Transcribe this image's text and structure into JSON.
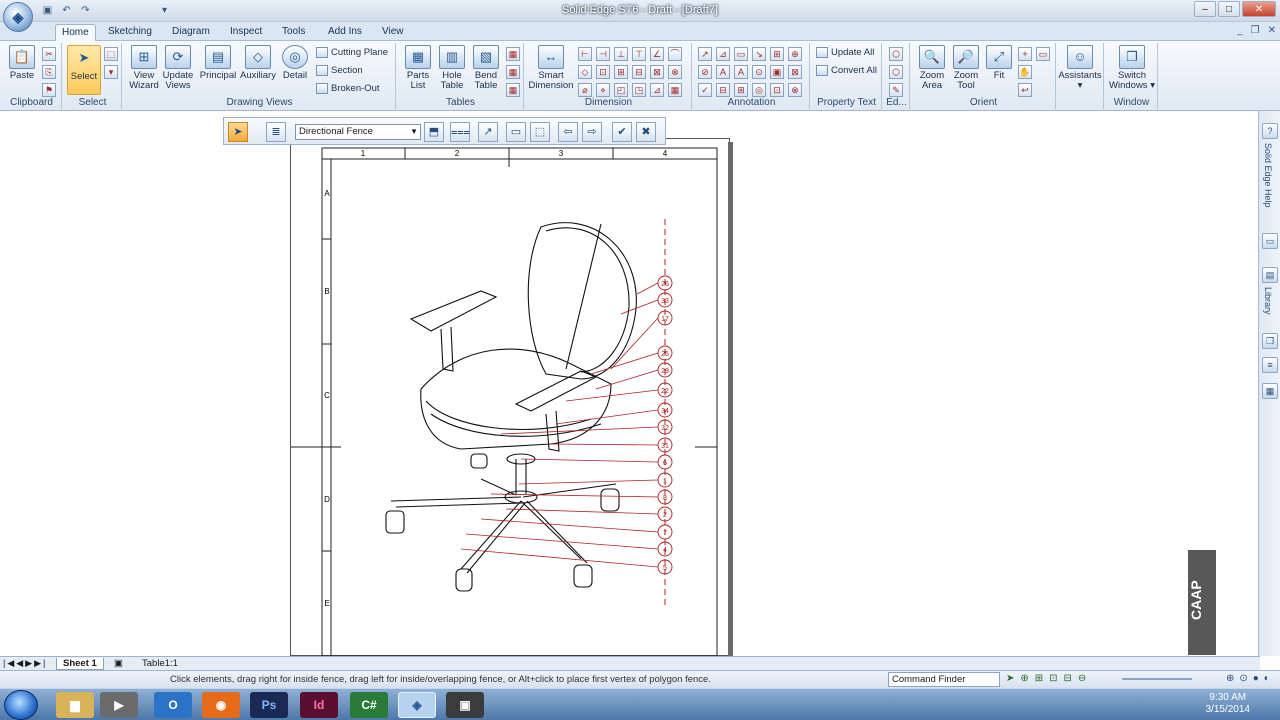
{
  "window": {
    "title": "Solid Edge ST6 - Draft - [Draft7]"
  },
  "tabs": [
    "Home",
    "Sketching",
    "Diagram",
    "Inspect",
    "Tools",
    "Add Ins",
    "View"
  ],
  "ribbon": {
    "clipboard": {
      "label": "Clipboard",
      "paste": "Paste"
    },
    "select": {
      "label": "Select",
      "select": "Select"
    },
    "drawing_views": {
      "label": "Drawing Views",
      "view_wizard": "View Wizard",
      "update_views": "Update Views",
      "principal": "Principal",
      "auxiliary": "Auxiliary",
      "detail": "Detail",
      "cutting_plane": "Cutting Plane",
      "section": "Section",
      "broken_out": "Broken-Out"
    },
    "tables": {
      "label": "Tables",
      "parts_list": "Parts List",
      "hole_table": "Hole Table",
      "bend_table": "Bend Table"
    },
    "dimension": {
      "label": "Dimension",
      "smart_dimension": "Smart Dimension"
    },
    "annotation": {
      "label": "Annotation"
    },
    "property_text": {
      "label": "Property Text",
      "update_all": "Update All",
      "convert_all": "Convert All"
    },
    "edit": {
      "label": "Ed..."
    },
    "orient": {
      "label": "Orient",
      "zoom_area": "Zoom Area",
      "zoom_tool": "Zoom Tool",
      "fit": "Fit"
    },
    "assistants": {
      "label": "Assistants"
    },
    "window_group": {
      "label": "Window",
      "switch_windows": "Switch Windows"
    }
  },
  "fence_toolbar": {
    "mode": "Directional Fence"
  },
  "sheet": {
    "columns": [
      "1",
      "2",
      "3",
      "4"
    ],
    "rows": [
      "A",
      "B",
      "C",
      "D",
      "E"
    ],
    "balloons": [
      "26",
      "33",
      "17",
      "25",
      "29",
      "22",
      "34",
      "32",
      "31",
      "6",
      "1",
      "8",
      "2",
      "7",
      "4",
      "5"
    ]
  },
  "sheet_tabs": [
    "Sheet 1",
    "Table1:1"
  ],
  "right_panel": {
    "help": "Solid Edge Help",
    "library": "Library"
  },
  "status": {
    "message": "Click elements, drag right for inside fence, drag left for inside/overlapping fence, or Alt+click to place first vertex of polygon fence.",
    "command_finder": "Command Finder"
  },
  "watermark": "CAAP",
  "clock": {
    "time": "9:30 AM",
    "date": "3/15/2014"
  },
  "colors": {
    "accent": "#ffc95a",
    "ribbon": "#dfe8f3",
    "balloon": "#b02020",
    "taskbar": "#4d78a9"
  }
}
